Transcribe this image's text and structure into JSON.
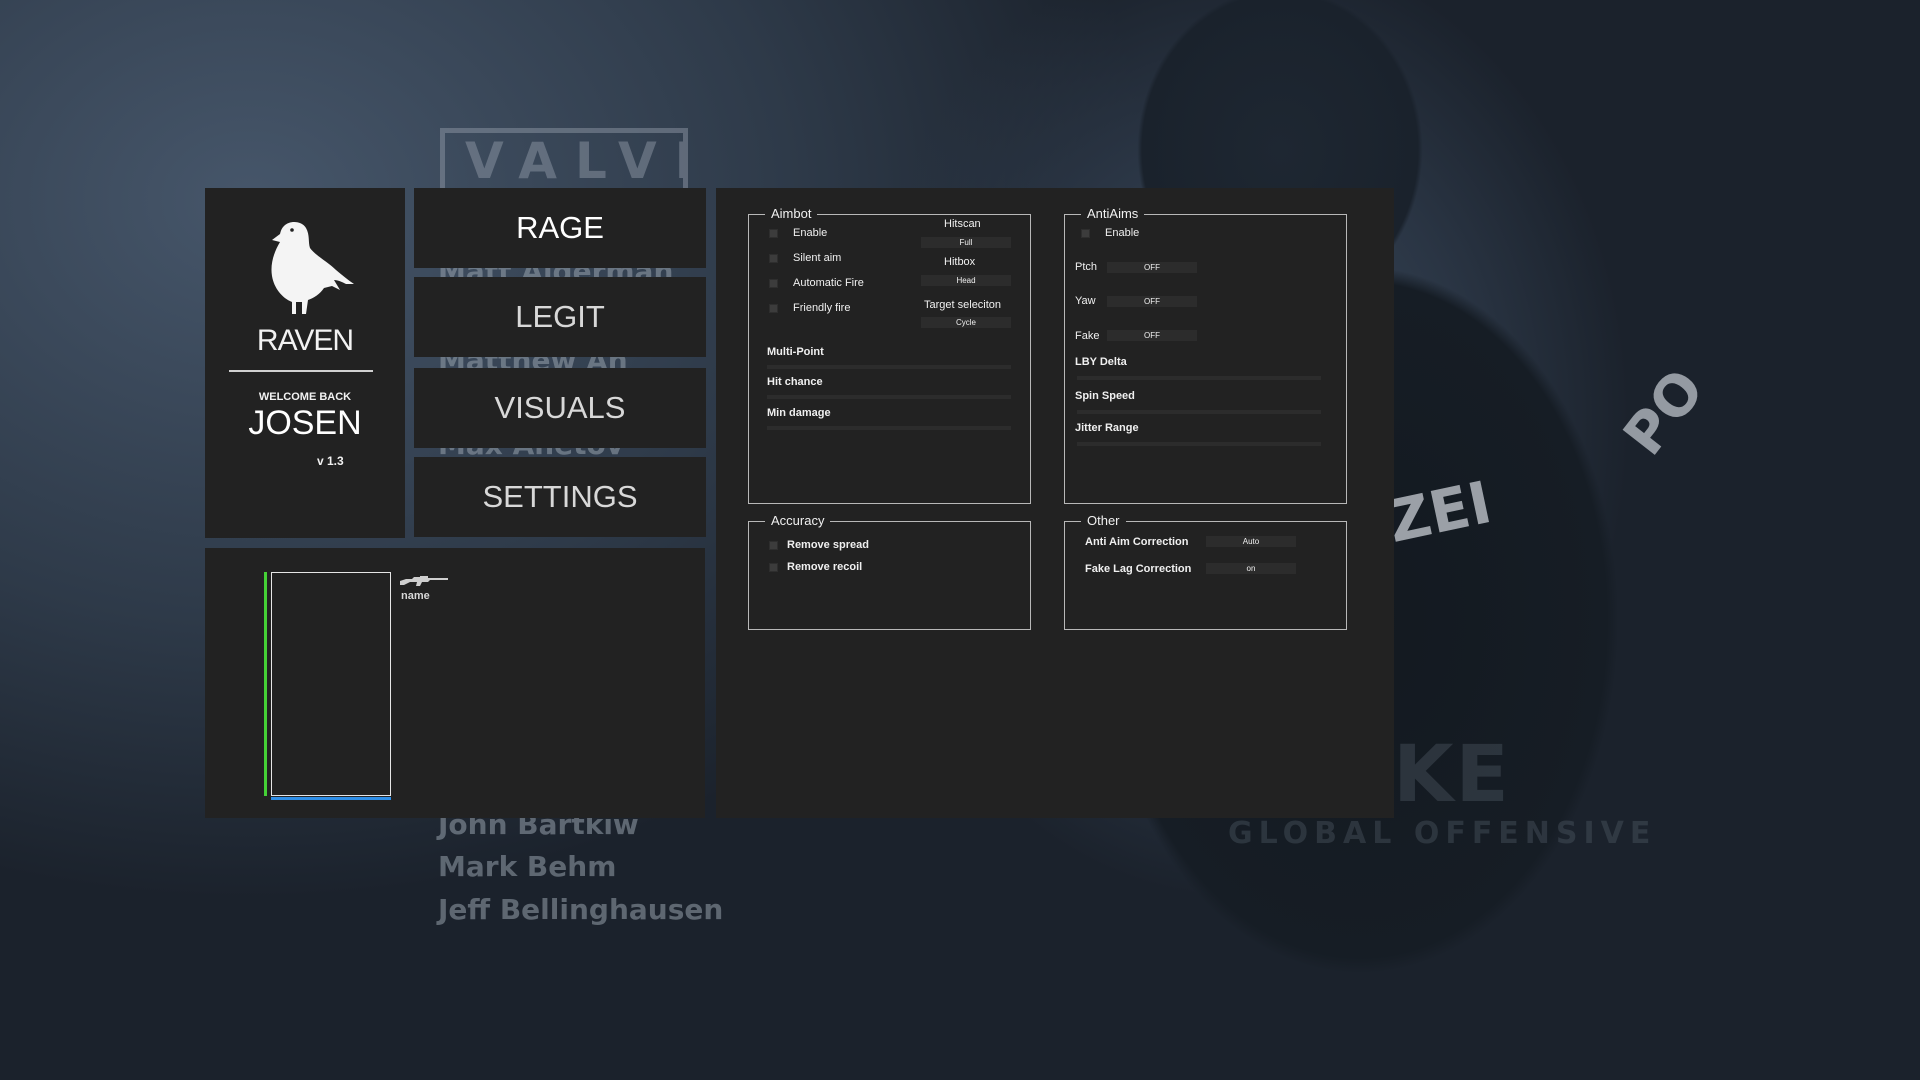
{
  "background": {
    "valve_text": "VALVE",
    "credits": [
      "Matt Alderman",
      "Matthew An",
      "Max Anetov",
      "John Bartkiw",
      "Mark Behm",
      "Jeff Bellinghausen"
    ],
    "zei_text": "ZEI",
    "po_text": "PO",
    "strike_text": "RIKE",
    "go_text": "GLOBAL OFFENSIVE"
  },
  "brand": {
    "name": "RAVEN",
    "welcome": "WELCOME BACK",
    "username": "JOSEN",
    "version": "v 1.3",
    "logo_icon": "raven-icon"
  },
  "tabs": [
    {
      "label": "RAGE",
      "active": true
    },
    {
      "label": "LEGIT",
      "active": false
    },
    {
      "label": "VISUALS",
      "active": false
    },
    {
      "label": "SETTINGS",
      "active": false
    }
  ],
  "preview": {
    "weapon_icon": "rifle-icon",
    "weapon_name": "name",
    "health_color": "#45d136",
    "armor_color": "#2f8fe8"
  },
  "aimbot": {
    "title": "Aimbot",
    "checkboxes": [
      "Enable",
      "Silent aim",
      "Automatic Fire",
      "Friendly fire"
    ],
    "hitscan_label": "Hitscan",
    "hitscan_value": "Full",
    "hitbox_label": "Hitbox",
    "hitbox_value": "Head",
    "target_label": "Target seleciton",
    "target_value": "Cycle",
    "sliders": [
      "Multi-Point",
      "Hit chance",
      "Min damage"
    ]
  },
  "antiaims": {
    "title": "AntiAims",
    "enable": "Enable",
    "pitch_label": "Ptch",
    "pitch_value": "OFF",
    "yaw_label": "Yaw",
    "yaw_value": "OFF",
    "fake_label": "Fake",
    "fake_value": "OFF",
    "sliders": [
      "LBY Delta",
      "Spin Speed",
      "Jitter Range"
    ]
  },
  "accuracy": {
    "title": "Accuracy",
    "checkboxes": [
      "Remove spread",
      "Remove recoil"
    ]
  },
  "other": {
    "title": "Other",
    "aa_correction_label": "Anti Aim Correction",
    "aa_correction_value": "Auto",
    "fakelag_correction_label": "Fake Lag Correction",
    "fakelag_correction_value": "on"
  }
}
